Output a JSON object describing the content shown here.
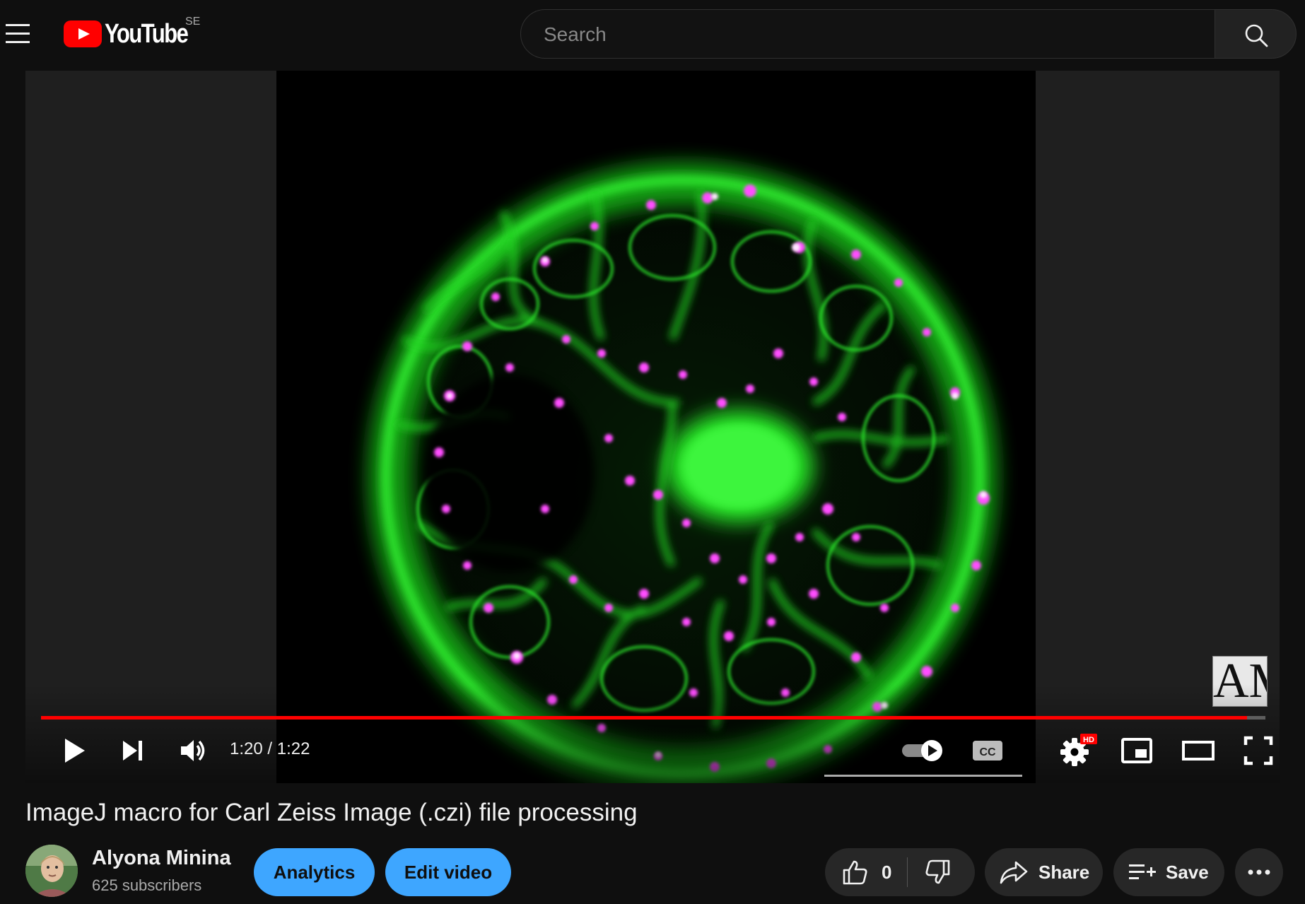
{
  "header": {
    "logo_text": "YouTube",
    "country_code": "SE",
    "search_placeholder": "Search"
  },
  "player": {
    "time_current": "1:20",
    "time_separator": " / ",
    "time_total": "1:22",
    "progress": 0.985,
    "watermark_text": "AM",
    "settings_badge": "HD",
    "cc_label": "CC"
  },
  "video": {
    "title": "ImageJ macro for Carl Zeiss Image (.czi) file processing"
  },
  "channel": {
    "name": "Alyona Minina",
    "subscribers": "625 subscribers"
  },
  "actions": {
    "analytics_label": "Analytics",
    "edit_label": "Edit video",
    "like_count": "0",
    "share_label": "Share",
    "save_label": "Save"
  },
  "colors": {
    "accent": "#ff0000",
    "blue_button": "#3ea6ff",
    "background": "#0f0f0f",
    "cell_green": "#22dd22",
    "cell_magenta": "#ff44ff"
  }
}
